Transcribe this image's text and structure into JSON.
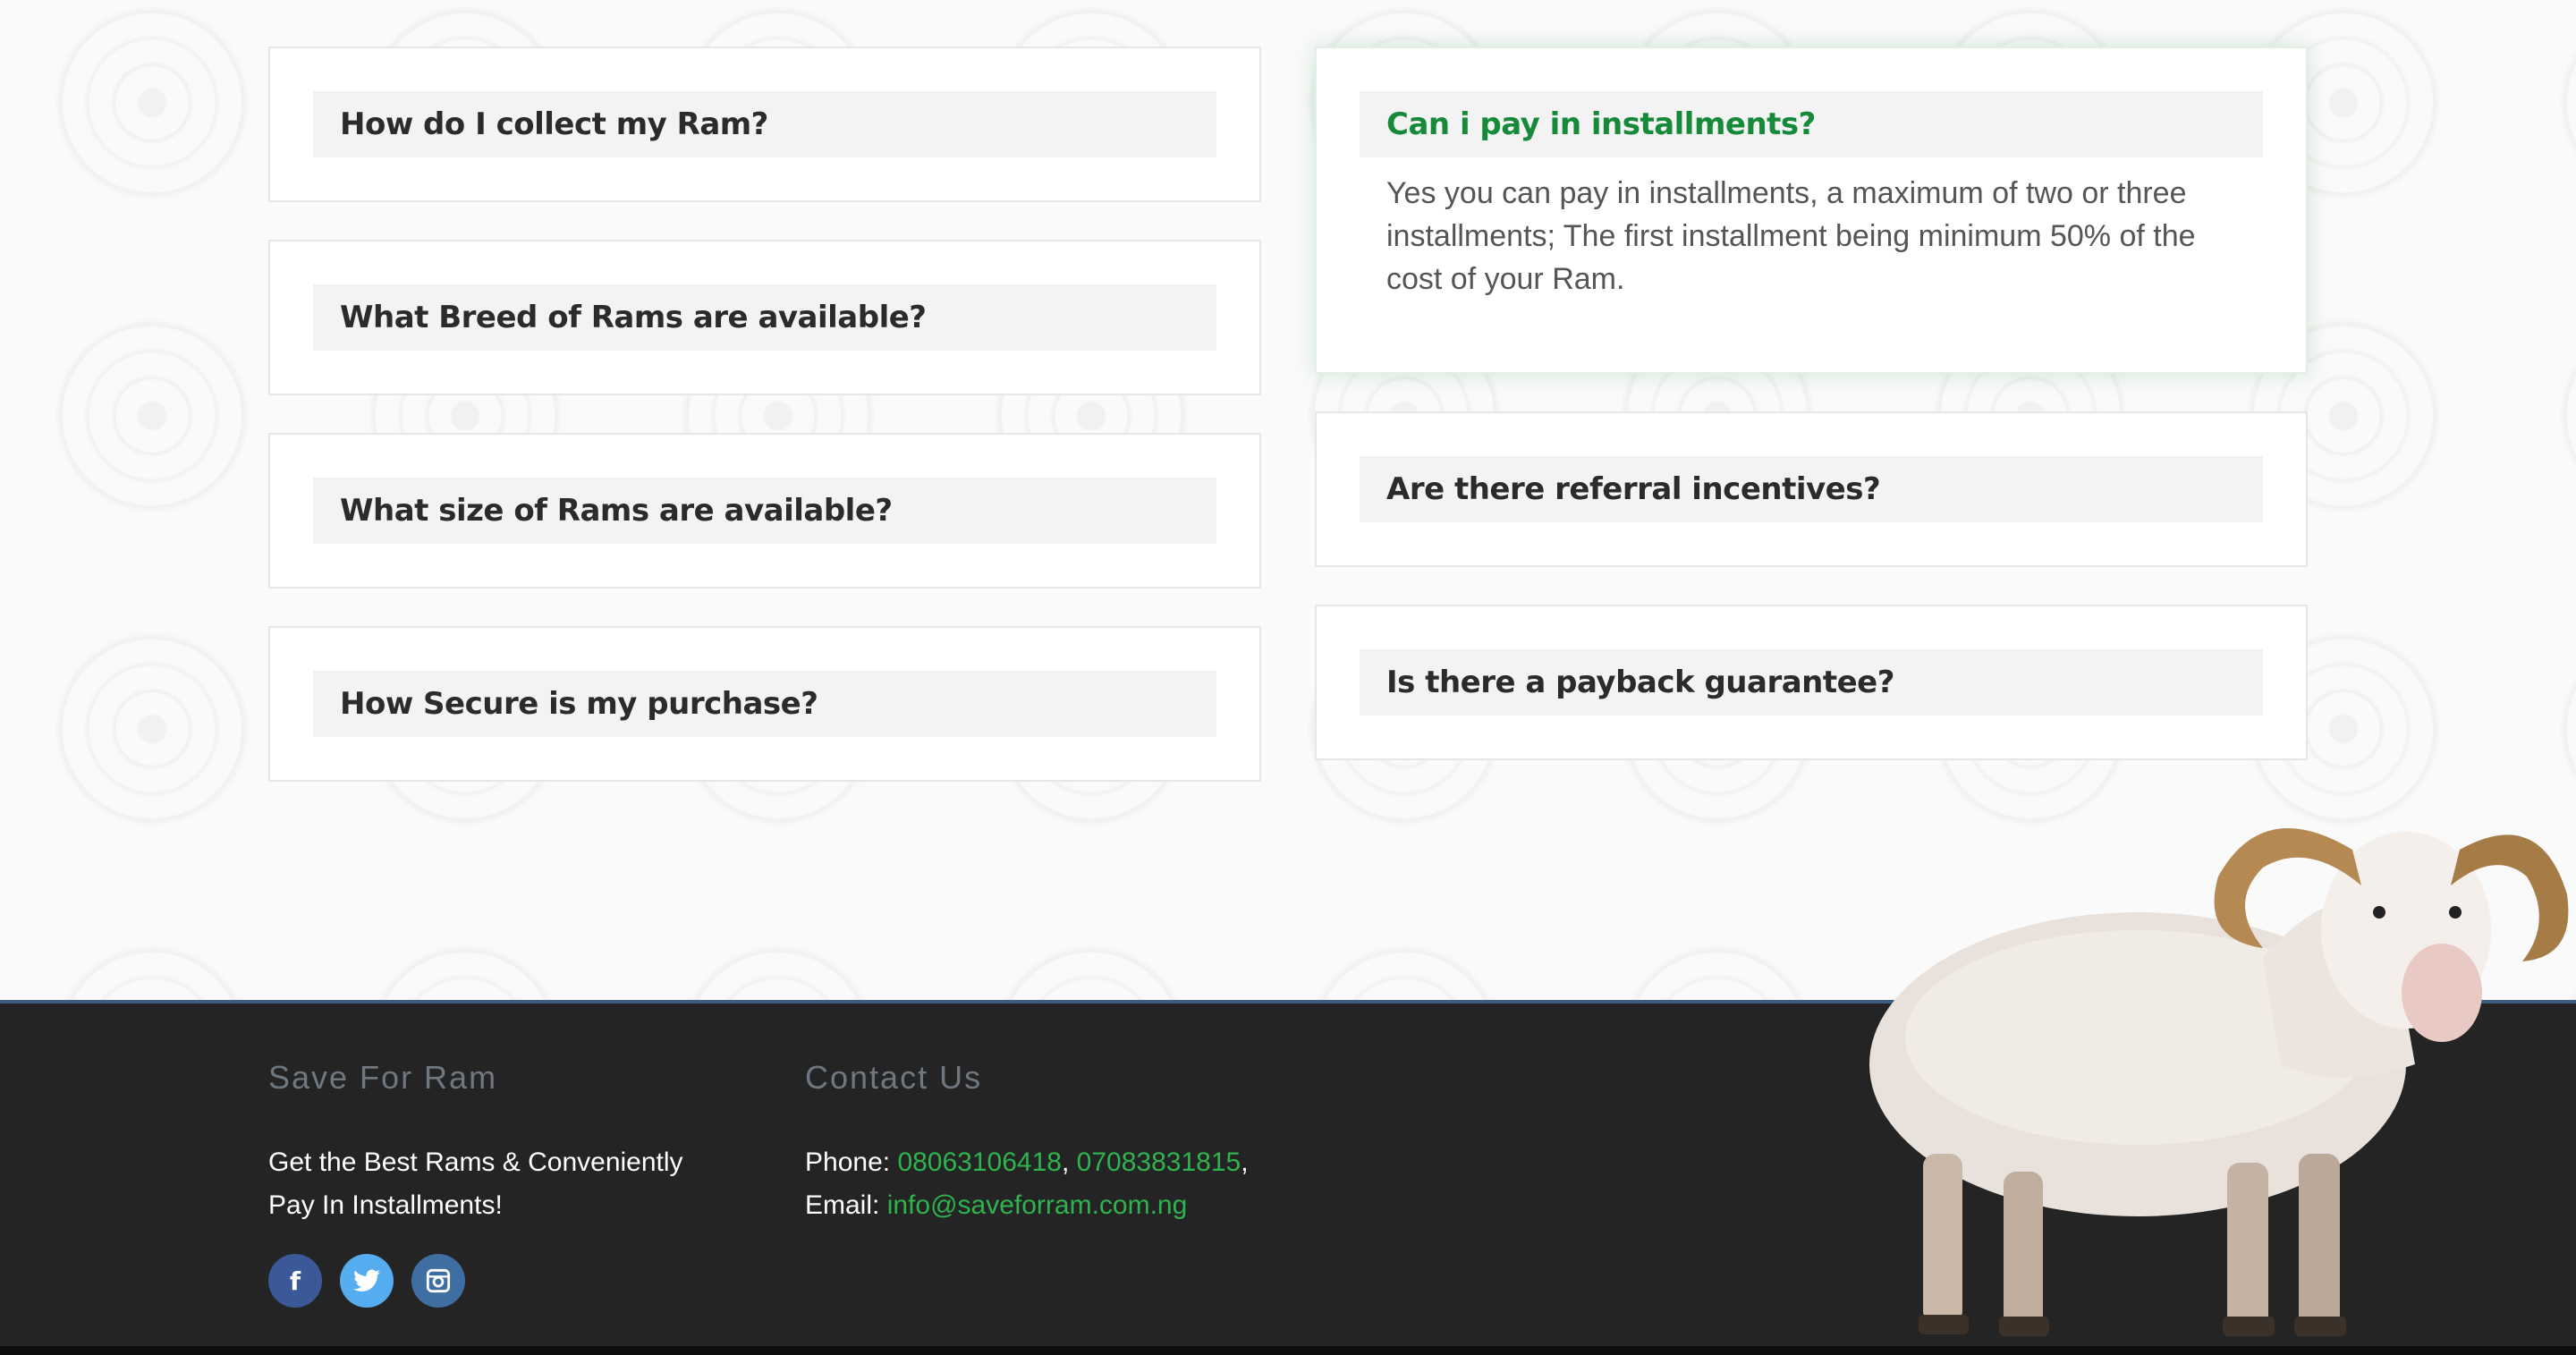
{
  "faq": {
    "left": [
      {
        "question": "How do I collect my Ram?"
      },
      {
        "question": "What Breed of Rams are available?"
      },
      {
        "question": "What size of Rams are available?"
      },
      {
        "question": "How Secure is my purchase?"
      }
    ],
    "right": [
      {
        "question": "Can i pay in installments?",
        "answer": "Yes you can pay in installments, a maximum of two or three installments; The first installment being minimum 50% of the cost of your Ram."
      },
      {
        "question": "Are there referral incentives?"
      },
      {
        "question": "Is there a payback guarantee?"
      }
    ]
  },
  "footer": {
    "about": {
      "title": "Save For Ram",
      "text_line1": "Get the Best Rams & Conveniently",
      "text_line2": "Pay In Installments!"
    },
    "contact": {
      "title": "Contact Us",
      "phone_label": "Phone:",
      "phone1": "08063106418",
      "phone2": "07083831815",
      "email_label": "Email:",
      "email": "info@saveforram.com.ng"
    },
    "socials": [
      {
        "name": "facebook",
        "glyph": "f"
      },
      {
        "name": "twitter",
        "glyph": "t"
      },
      {
        "name": "instagram",
        "glyph": "◘"
      }
    ]
  },
  "colors": {
    "accent_green": "#178a3a",
    "link_green": "#2fb34e",
    "footer_bg": "#242424"
  }
}
